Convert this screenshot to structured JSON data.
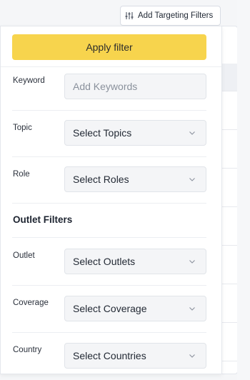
{
  "trigger": {
    "label": "Add Targeting Filters",
    "icon": "sliders-icon"
  },
  "panel": {
    "apply_label": "Apply filter",
    "accent_color": "#f7d44d",
    "rows": [
      {
        "label": "Keyword",
        "placeholder": "Add Keywords",
        "type": "text"
      },
      {
        "label": "Topic",
        "value": "Select Topics",
        "type": "select"
      },
      {
        "label": "Role",
        "value": "Select Roles",
        "type": "select"
      }
    ],
    "section_title": "Outlet Filters",
    "outlet_rows": [
      {
        "label": "Outlet",
        "value": "Select Outlets",
        "type": "select"
      },
      {
        "label": "Coverage",
        "value": "Select Coverage",
        "type": "select"
      },
      {
        "label": "Country",
        "value": "Select Countries",
        "type": "select"
      }
    ]
  }
}
